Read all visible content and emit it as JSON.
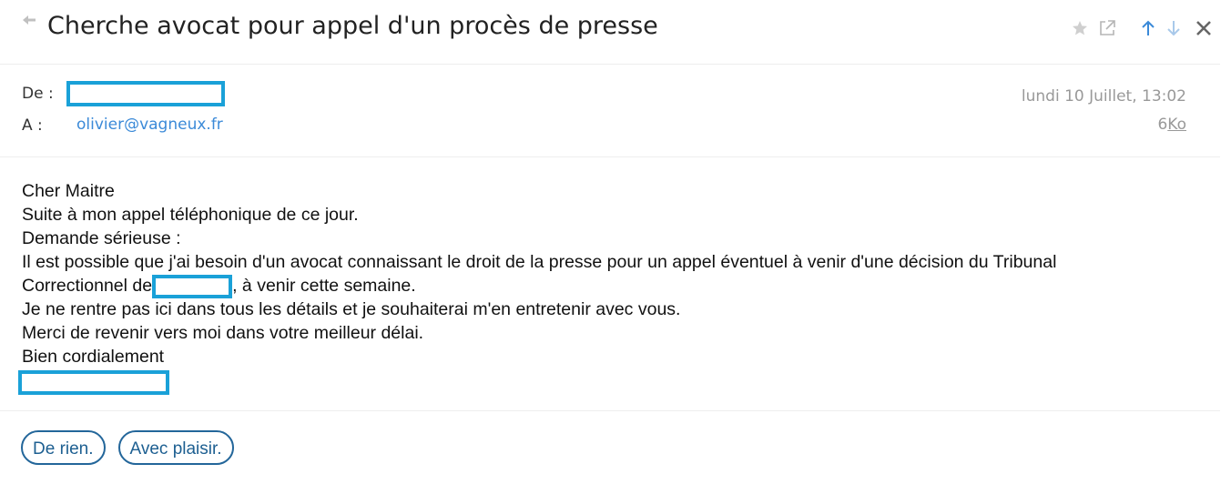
{
  "header": {
    "subject": "Cherche avocat pour appel d'un procès de presse",
    "icons": [
      "reply-arrow-icon",
      "star-icon",
      "open-external-icon",
      "arrow-up-icon",
      "arrow-down-icon",
      "close-icon"
    ],
    "colors": {
      "arrow_blue": "#3b8ad8",
      "muted_gray": "#b5b5b5",
      "close_gray": "#666666"
    }
  },
  "meta": {
    "from_label": "De :",
    "to_label": "A :",
    "to_address": "olivier@vagneux.fr",
    "date": "lundi 10 Juillet, 13:02",
    "size_number": "6",
    "size_unit": "Ko",
    "redaction_color": "#1aa1d8"
  },
  "message": {
    "line1": "Cher Maitre",
    "line2": "Suite à mon appel téléphonique de ce jour.",
    "line3": "Demande sérieuse :",
    "line4": "Il est possible que j'ai besoin d'un avocat connaissant le droit de la presse pour un appel éventuel à venir d'une décision du Tribunal",
    "line5_before": "Correctionnel de",
    "line5_after": ", à venir cette semaine.",
    "line6": "Je ne rentre pas ici dans tous les détails et je souhaiterai m'en entretenir avec vous.",
    "line7": "Merci de revenir vers moi dans votre meilleur délai.",
    "line8": "Bien cordialement"
  },
  "quick_replies": {
    "reply1": "De rien.",
    "reply2": "Avec plaisir.",
    "border_color": "#23669a"
  }
}
